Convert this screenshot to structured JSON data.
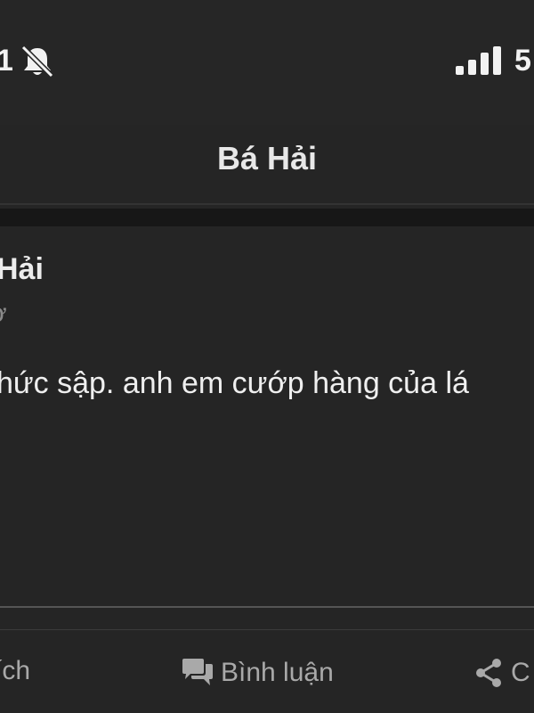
{
  "status_bar": {
    "time": "1",
    "battery": "5"
  },
  "header": {
    "title": "Bá Hải"
  },
  "post": {
    "author": "Hải",
    "time": "ờ",
    "body": "hức sập. anh em cướp hàng của lá"
  },
  "actions": {
    "like_label": "ích",
    "comment_label": "Bình luận",
    "share_label": "C"
  },
  "icons": {
    "bell": "bell-off-icon",
    "signal": "signal-icon",
    "comment": "comment-icon",
    "share": "share-icon"
  }
}
